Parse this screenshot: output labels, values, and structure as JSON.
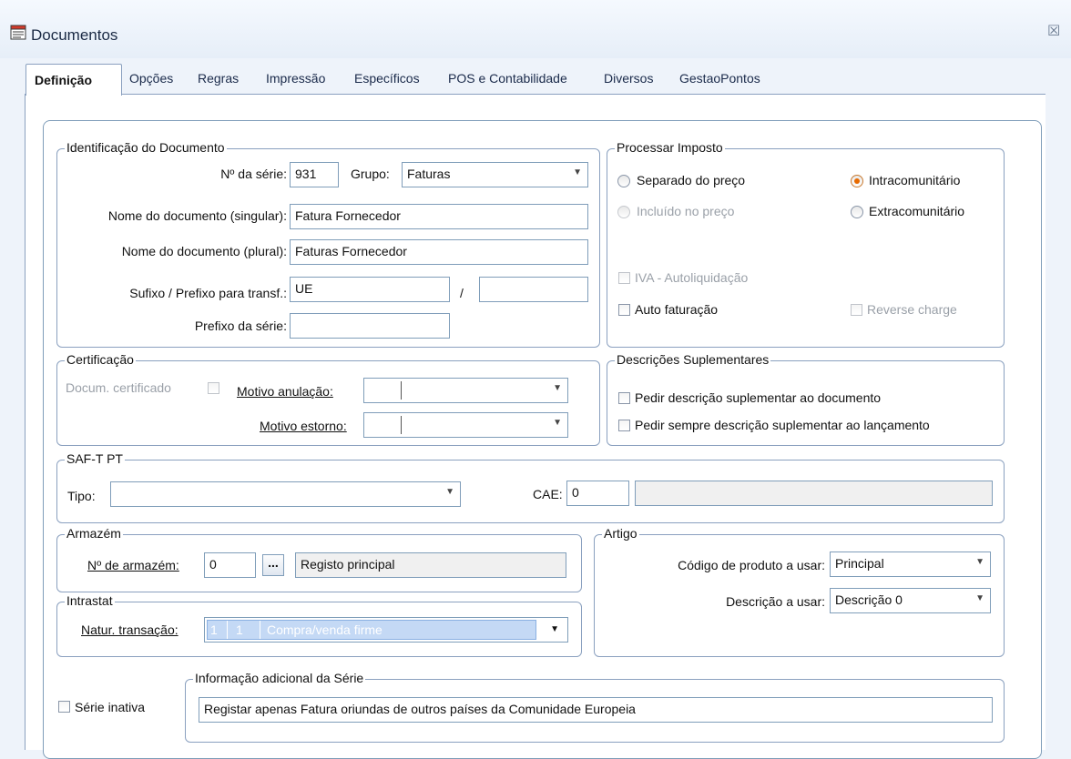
{
  "window": {
    "title": "Documentos",
    "close_glyph": "☒"
  },
  "tabs": [
    {
      "label": "Definição"
    },
    {
      "label": "Opções"
    },
    {
      "label": "Regras"
    },
    {
      "label": "Impressão"
    },
    {
      "label": "Específicos"
    },
    {
      "label": "POS e Contabilidade"
    },
    {
      "label": "Diversos"
    },
    {
      "label": "GestaoPontos"
    }
  ],
  "ident": {
    "legend": "Identificação do Documento",
    "serie_label": "Nº da série:",
    "serie_value": "931",
    "grupo_label": "Grupo:",
    "grupo_value": "Faturas",
    "nome_sing_label": "Nome do documento (singular):",
    "nome_sing_value": "Fatura Fornecedor",
    "nome_plural_label": "Nome do documento (plural):",
    "nome_plural_value": "Faturas Fornecedor",
    "sufixo_label": "Sufixo / Prefixo para transf.:",
    "sufixo_value": "UE",
    "slash": "/",
    "prefixo_transf_value": "",
    "prefixo_serie_label": "Prefixo da série:",
    "prefixo_serie_value": ""
  },
  "imposto": {
    "legend": "Processar Imposto",
    "separado": "Separado do preço",
    "incluido": "Incluído no preço",
    "intra": "Intracomunitário",
    "extra": "Extracomunitário",
    "iva": "IVA - Autoliquidação",
    "auto": "Auto faturação",
    "reverse": "Reverse charge"
  },
  "cert": {
    "legend": "Certificação",
    "docum": "Docum. certificado",
    "motivo_anul": "Motivo anulação:",
    "motivo_estorno": "Motivo estorno:"
  },
  "descr": {
    "legend": "Descrições Suplementares",
    "pedir_doc": "Pedir descrição suplementar ao documento",
    "pedir_lanc": "Pedir sempre descrição suplementar ao lançamento"
  },
  "saft": {
    "legend": "SAF-T PT",
    "tipo": "Tipo:",
    "cae": "CAE:",
    "cae_value": "0",
    "cae_desc": ""
  },
  "armazem": {
    "legend": "Armazém",
    "label": "Nº de armazém:",
    "value": "0",
    "btn": "...",
    "desc": "Registo principal"
  },
  "artigo": {
    "legend": "Artigo",
    "codigo_label": "Código de produto a usar:",
    "codigo_value": "Principal",
    "descricao_label": "Descrição a usar:",
    "descricao_value": "Descrição 0"
  },
  "intrastat": {
    "legend": "Intrastat",
    "label": "Natur. transação:",
    "c1": "1",
    "c2": "1",
    "c3": "Compra/venda firme"
  },
  "serie_inativa": "Série inativa",
  "info": {
    "legend": "Informação adicional da Série",
    "value": "Registar apenas Fatura oriundas de outros países da Comunidade Europeia"
  },
  "colors": {
    "accent": "#e86a00",
    "border": "#7f9db9",
    "selection": "#c4d9f5"
  }
}
